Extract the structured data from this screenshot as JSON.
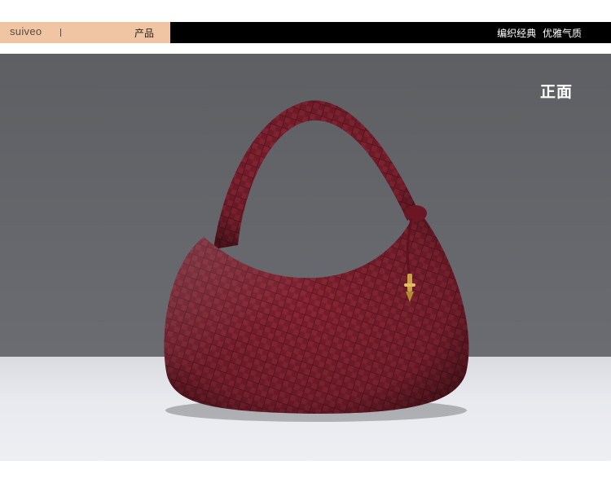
{
  "header": {
    "brand_logo": "suiveo",
    "category": "产品",
    "tagline": "编织经典 优雅气质"
  },
  "product_image": {
    "view_label": "正面",
    "bag_color": "#7a1e2c",
    "background_color": "#64666b",
    "hardware_color": "#c9a24a"
  }
}
